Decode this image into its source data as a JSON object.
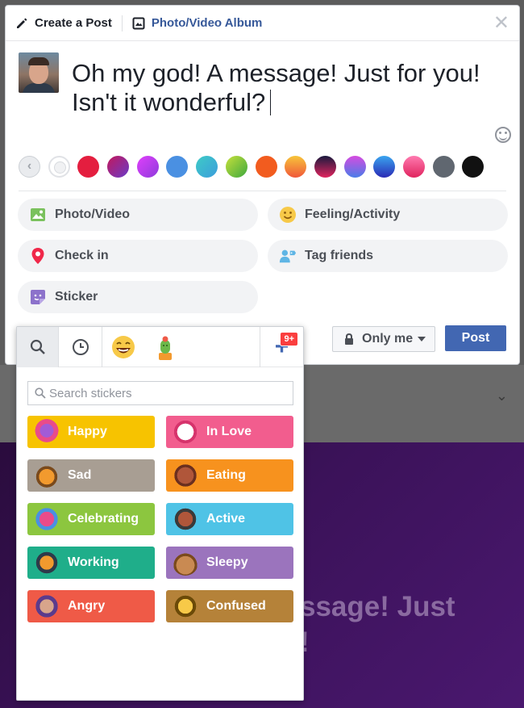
{
  "composer": {
    "tabs": [
      {
        "label": "Create a Post",
        "icon": "pencil-icon"
      },
      {
        "label": "Photo/Video Album",
        "icon": "album-icon"
      }
    ],
    "message_line1": "Oh my god! A message! Just for you!",
    "message_line2": "Isn't it wonderful?",
    "background_swatches": [
      "#e41e3f",
      "#8e3bdc",
      "#b64ceb",
      "#4a90e2",
      "#3ecbc6",
      "#6cc04a",
      "#f25c1f",
      "#f6a33a",
      "#c2185b",
      "#8f5be0",
      "#3a4fd6",
      "#ff3e83",
      "#606770",
      "#111111"
    ],
    "actions": [
      {
        "label": "Photo/Video",
        "icon": "photo-icon"
      },
      {
        "label": "Feeling/Activity",
        "icon": "smiley-icon"
      },
      {
        "label": "Check in",
        "icon": "location-pin-icon"
      },
      {
        "label": "Tag friends",
        "icon": "tag-friends-icon"
      },
      {
        "label": "Sticker",
        "icon": "sticker-icon"
      }
    ],
    "privacy_label": "Only me",
    "post_label": "Post"
  },
  "sticker_panel": {
    "badge": "9+",
    "search_placeholder": "Search stickers",
    "categories": [
      {
        "label": "Happy",
        "color": "#f7c300"
      },
      {
        "label": "In Love",
        "color": "#f25d8e"
      },
      {
        "label": "Sad",
        "color": "#a89e93"
      },
      {
        "label": "Eating",
        "color": "#f7921e"
      },
      {
        "label": "Celebrating",
        "color": "#8cc63f"
      },
      {
        "label": "Active",
        "color": "#4fc3e6"
      },
      {
        "label": "Working",
        "color": "#1fae8a"
      },
      {
        "label": "Sleepy",
        "color": "#9b74bd"
      },
      {
        "label": "Angry",
        "color": "#ef5a47"
      },
      {
        "label": "Confused",
        "color": "#b58239"
      }
    ]
  },
  "background_post_text": "ssage! Just\n!"
}
